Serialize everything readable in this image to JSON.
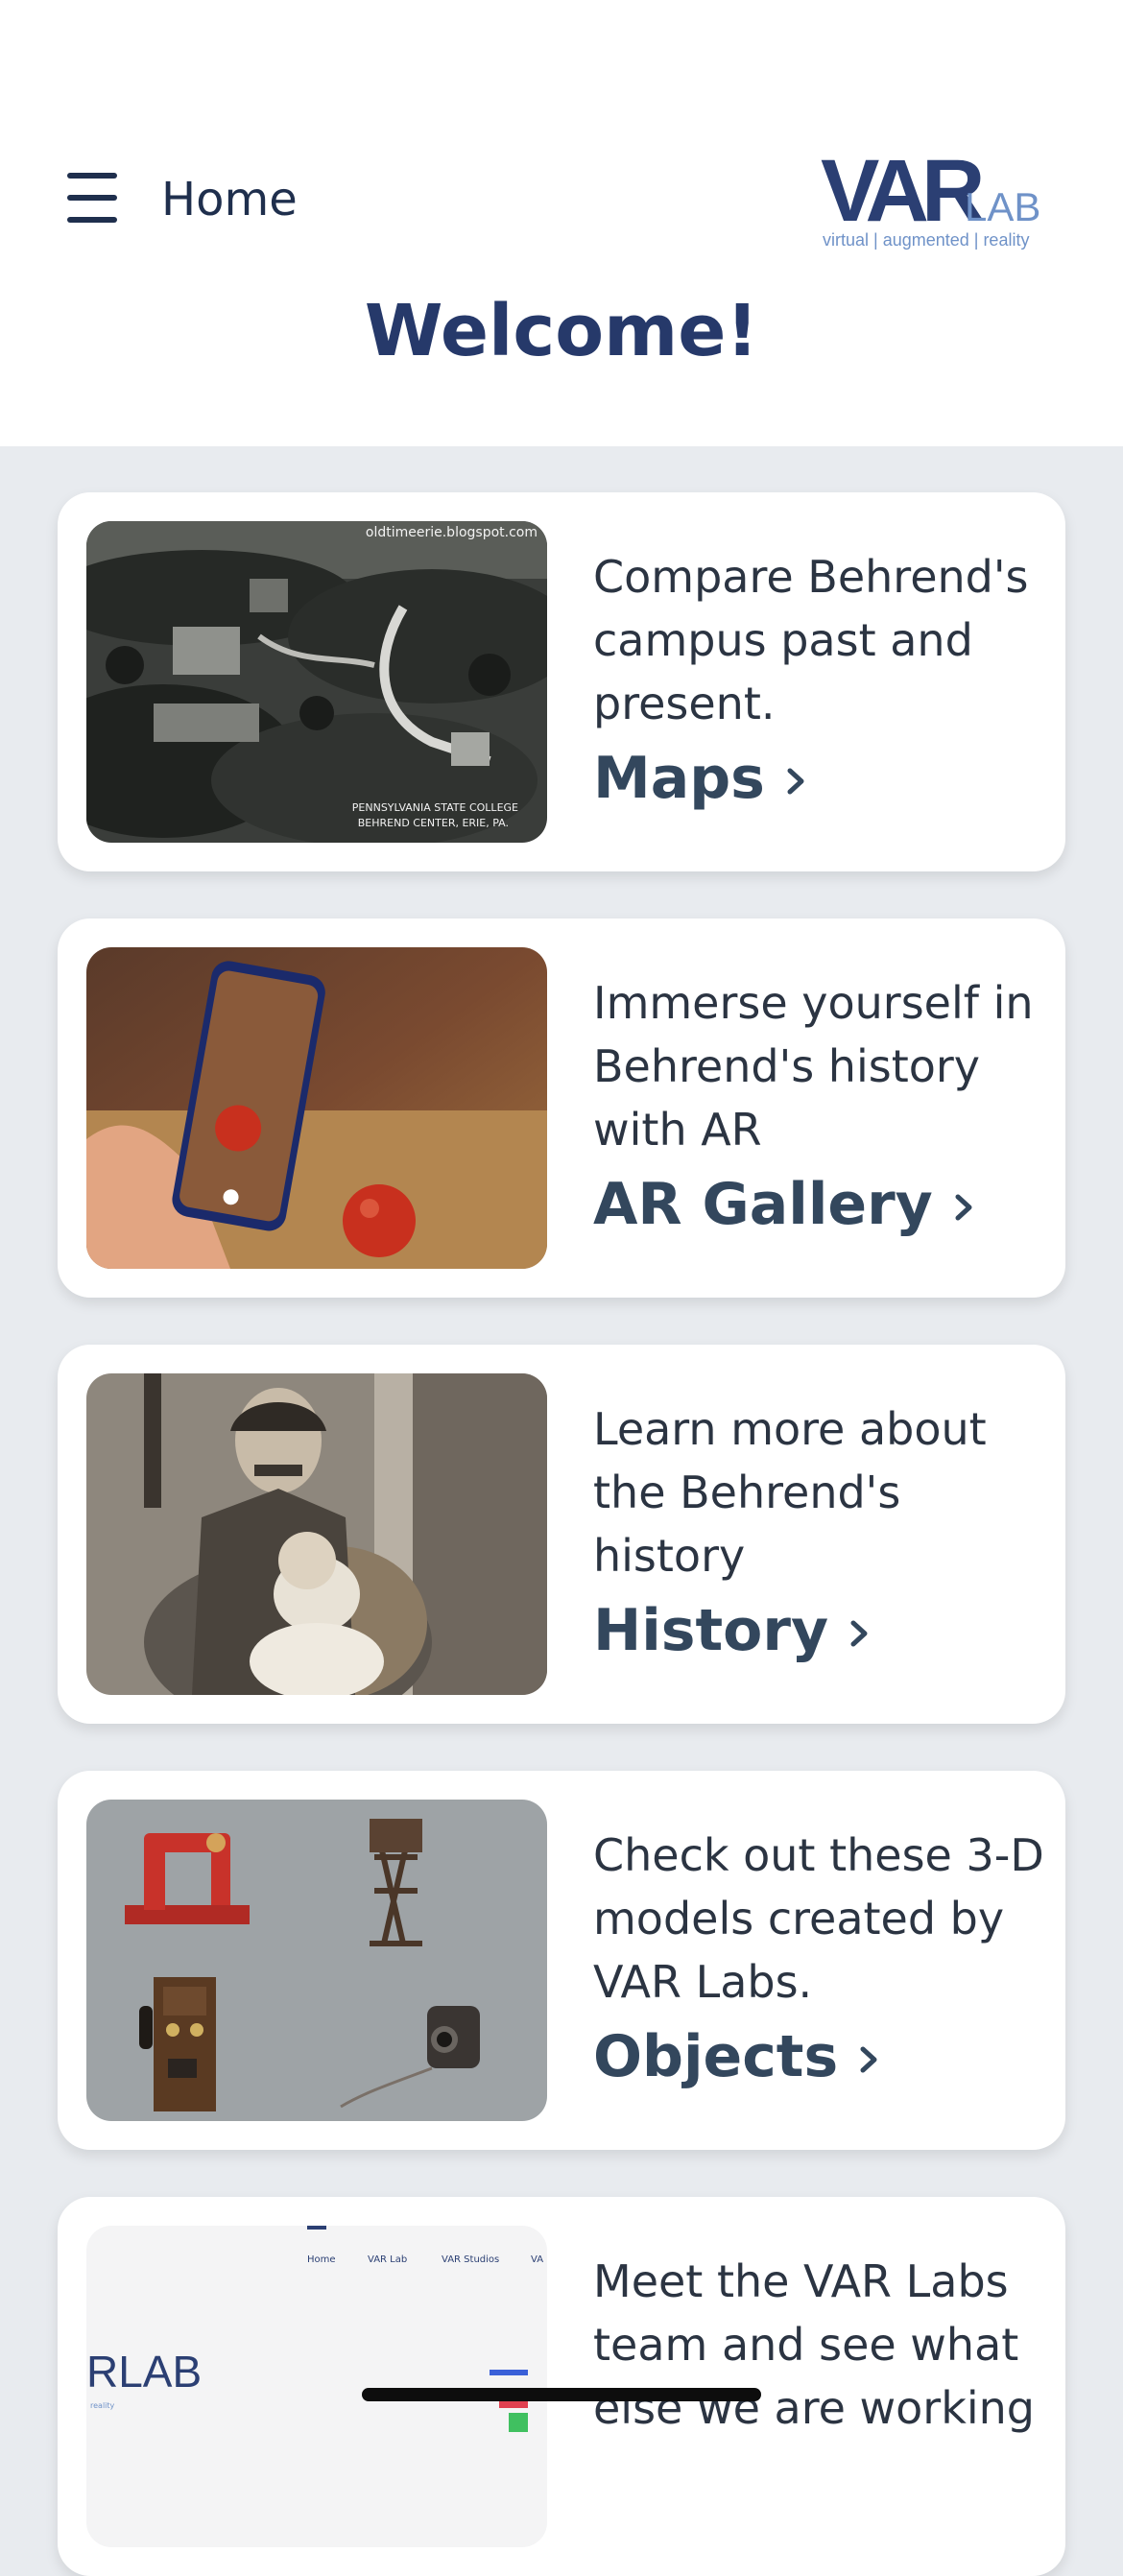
{
  "header": {
    "nav_label": "Home",
    "logo": {
      "main": "VAR",
      "sub": "LAB",
      "tagline": "virtual | augmented | reality"
    },
    "welcome": "Welcome!"
  },
  "cards": [
    {
      "description": "Compare Behrend's campus past and present.",
      "link": "Maps",
      "image_text": {
        "watermark": "oldtimeerie.blogspot.com",
        "caption_line1": "PENNSYLVANIA STATE COLLEGE",
        "caption_line2": "BEHREND CENTER, ERIE, PA."
      }
    },
    {
      "description": "Immerse yourself in Behrend's history with AR",
      "link": "AR Gallery"
    },
    {
      "description": "Learn more about the Behrend's history",
      "link": "History"
    },
    {
      "description": "Check out these 3-D models created by VAR Labs.",
      "link": "Objects"
    },
    {
      "description": "Meet the VAR Labs team and see what else we are working",
      "link": "",
      "image_text": {
        "nav_items": [
          "Home",
          "VAR Lab",
          "VAR Studios",
          "VA"
        ],
        "logo_part": "RLAB",
        "logo_tag": "reality"
      }
    }
  ],
  "colors": {
    "title": "#26396a",
    "text": "#2b3442",
    "link": "#33475d",
    "page_bg": "#e8ebef",
    "logo_blue": "#2b3f73",
    "logo_light": "#6f92c8"
  }
}
